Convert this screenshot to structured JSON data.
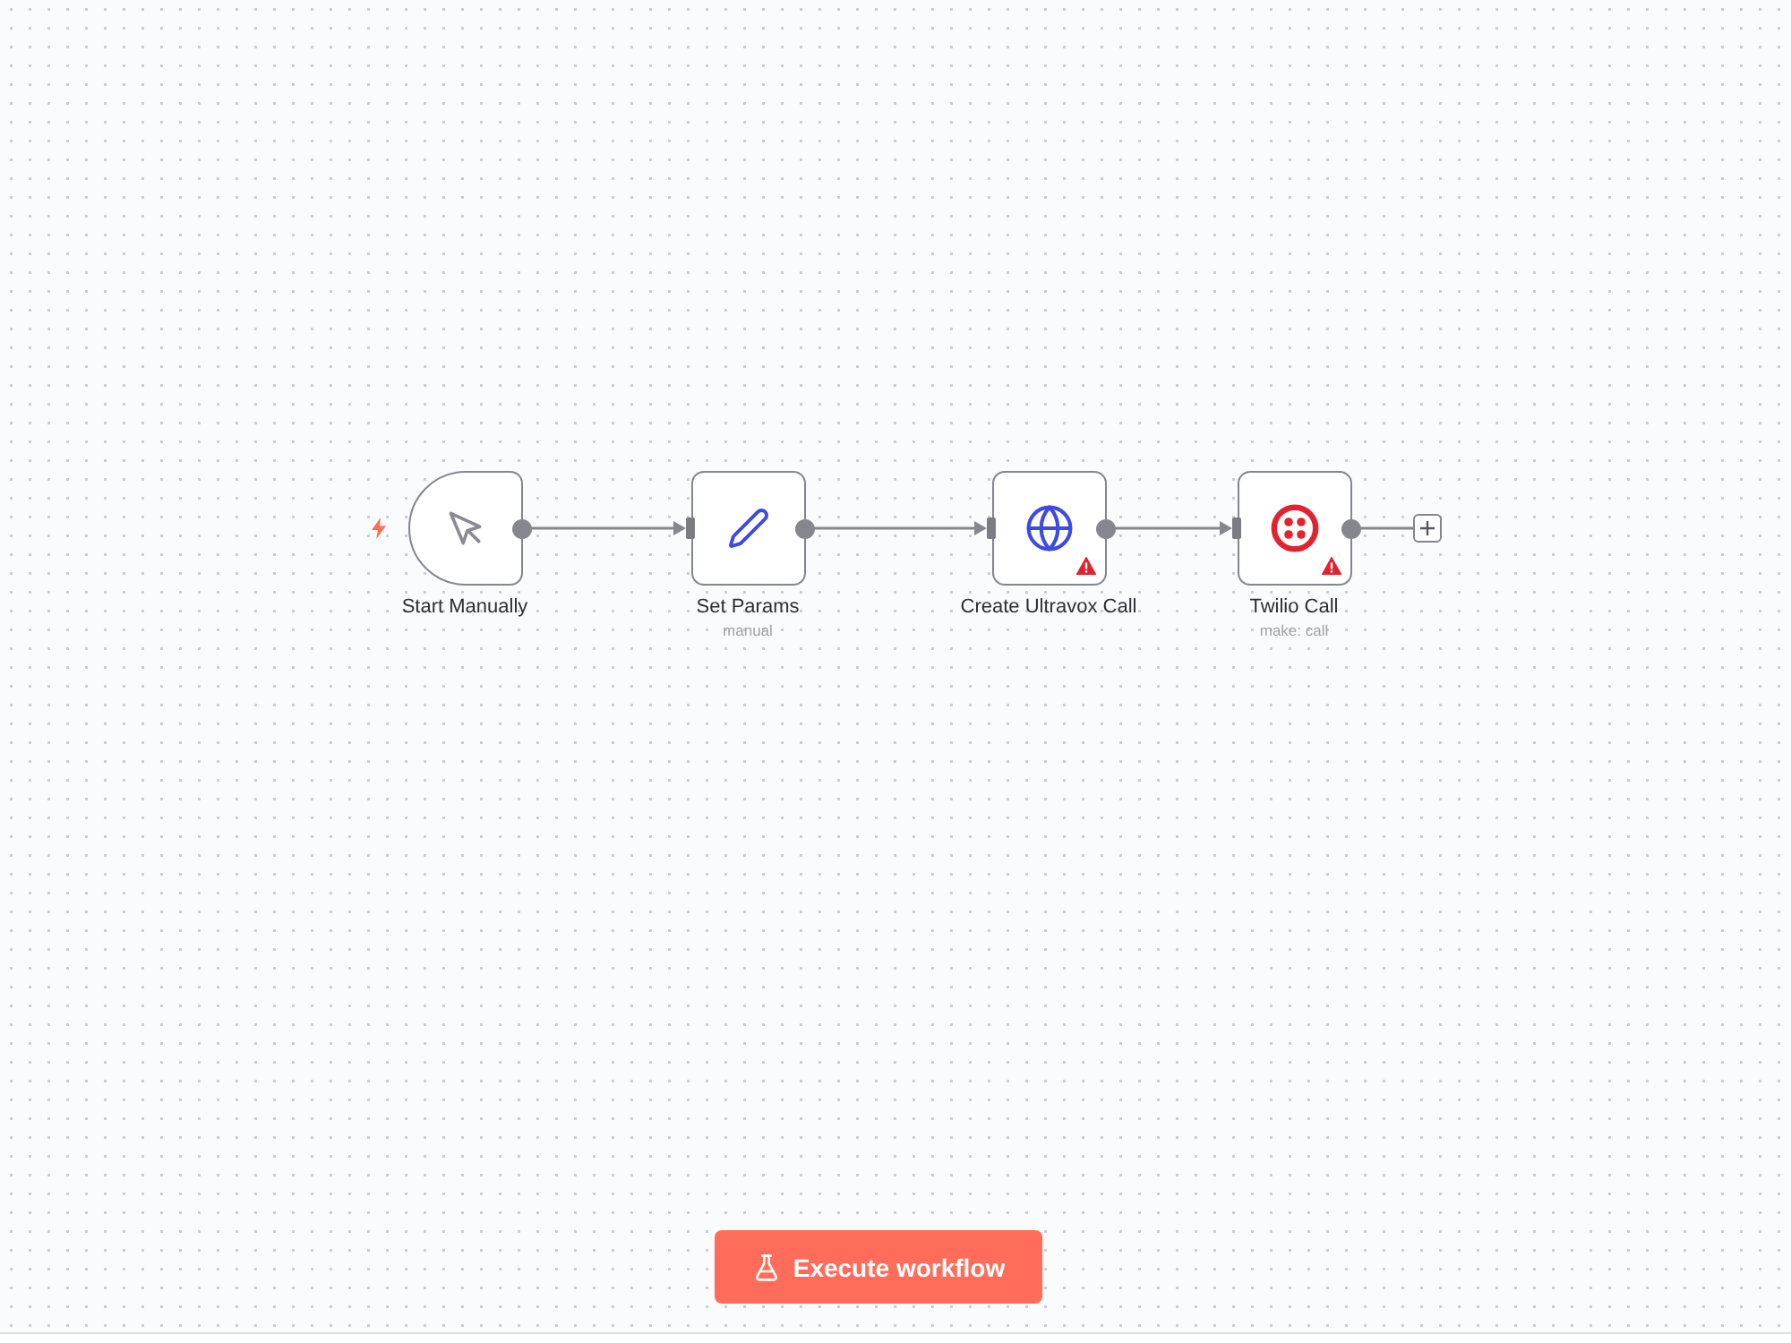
{
  "nodes": [
    {
      "kind": "trigger",
      "name": "Start Manually",
      "warning": false
    },
    {
      "kind": "set",
      "name": "Set Params",
      "subtitle": "manual",
      "warning": false
    },
    {
      "kind": "http",
      "name": "Create Ultravox Call",
      "warning": true
    },
    {
      "kind": "twilio",
      "name": "Twilio Call",
      "subtitle": "make: call",
      "warning": true
    }
  ],
  "execute_button": {
    "label": "Execute workflow"
  }
}
